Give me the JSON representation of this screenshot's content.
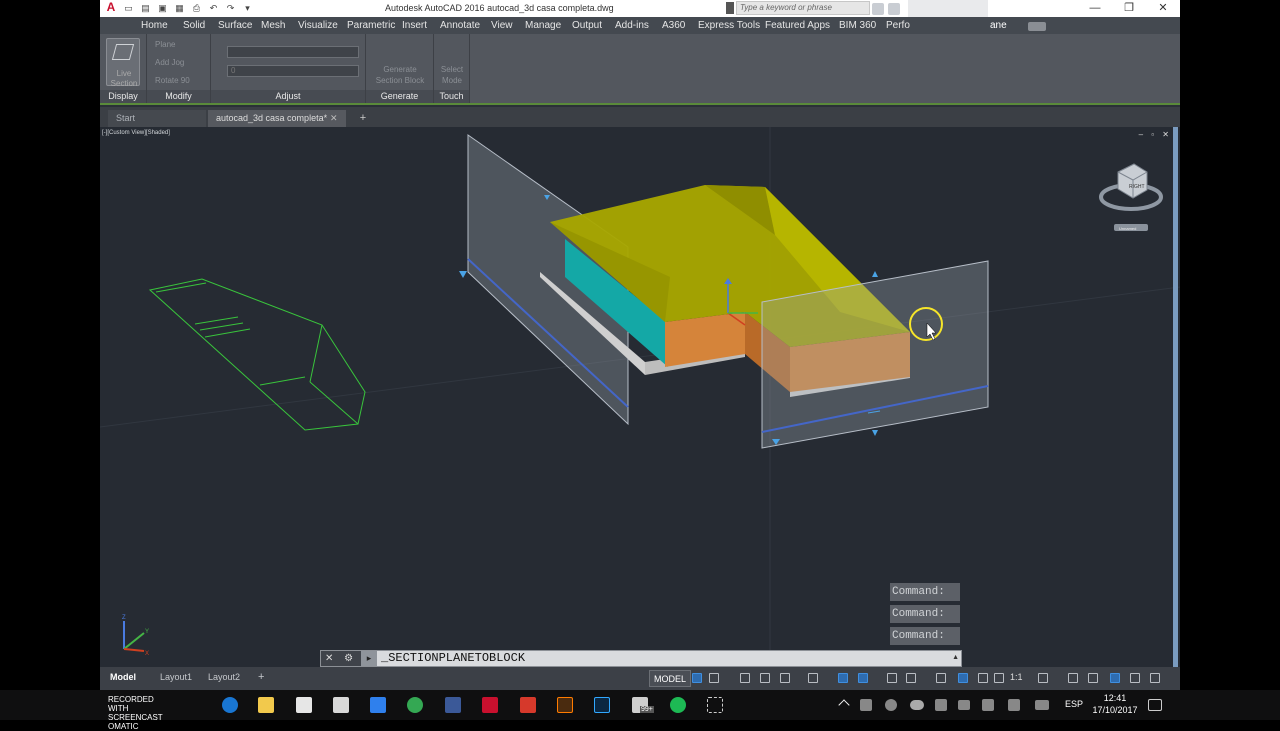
{
  "titlebar": {
    "title": "Autodesk AutoCAD 2016    autocad_3d casa completa.dwg",
    "search_placeholder": "Type a keyword or phrase",
    "min_glyph": "—",
    "restore_glyph": "❐",
    "close_glyph": "✕"
  },
  "ribbon_tabs": [
    "Home",
    "Solid",
    "Surface",
    "Mesh",
    "Visualize",
    "Parametric",
    "Insert",
    "Annotate",
    "View",
    "Manage",
    "Output",
    "Add-ins",
    "A360",
    "Express Tools",
    "Featured Apps",
    "BIM 360",
    "Perfo",
    "ane"
  ],
  "ribbon": {
    "display": {
      "button": "Live Section",
      "label": "Display"
    },
    "modify": {
      "plane": "Plane",
      "add_jog": "Add Jog",
      "rotate": "Rotate 90",
      "label": "Modify"
    },
    "adjust": {
      "field2": "0",
      "label": "Adjust"
    },
    "generate": {
      "button": "Generate Section Block",
      "label": "Generate"
    },
    "touch": {
      "button": "Select Mode",
      "label": "Touch"
    }
  },
  "doc_tabs": {
    "start": "Start",
    "active": "autocad_3d casa completa*",
    "close": "✕",
    "plus": "+"
  },
  "viewport": {
    "label": "[-][Custom View][Shaded]",
    "controls": "– ▫ ✕",
    "viewcube_face": "RIGHT",
    "viewcube_menu": "Unnamed",
    "ucs": {
      "x": "X",
      "y": "Y",
      "z": "Z"
    }
  },
  "command_history": [
    "Command:",
    "Command:",
    "Command:"
  ],
  "command_line": {
    "text": "_SECTIONPLANETOBLOCK",
    "buttons": "✕ ⚙"
  },
  "status": {
    "layouts": [
      "Model",
      "Layout1",
      "Layout2"
    ],
    "plus": "+",
    "model_button": "MODEL",
    "anno_scale": "1:1"
  },
  "taskbar": {
    "start_label": "RECORDED WITH SCREENCAST OMATIC",
    "language": "ESP",
    "time": "12:41",
    "date": "17/10/2017",
    "badge": "99+"
  },
  "colors": {
    "roof": "#a8a700",
    "wall": "#d5843a",
    "window": "#14a8a6",
    "wireframe": "#39c43c",
    "section_line": "#4466c8"
  }
}
